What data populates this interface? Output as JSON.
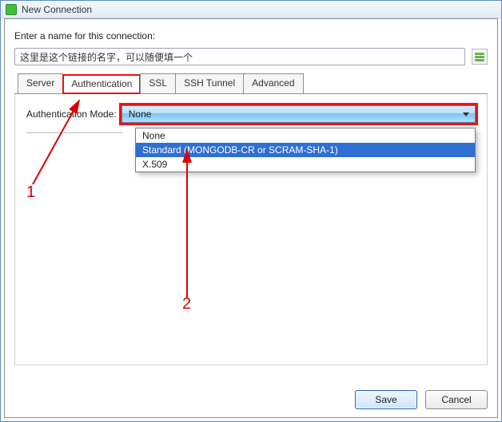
{
  "window": {
    "title": "New Connection"
  },
  "prompt": "Enter a name for this connection:",
  "connection_name": "这里是这个链接的名字，可以随便填一个",
  "tabs": {
    "server": "Server",
    "auth": "Authentication",
    "ssl": "SSL",
    "ssh": "SSH Tunnel",
    "advanced": "Advanced"
  },
  "auth": {
    "mode_label": "Authentication Mode:",
    "mode_value": "None",
    "options": {
      "none": "None",
      "standard": "Standard (MONGODB-CR or SCRAM-SHA-1)",
      "x509": "X.509"
    }
  },
  "buttons": {
    "save": "Save",
    "cancel": "Cancel"
  },
  "annotations": {
    "one": "1",
    "two": "2"
  }
}
